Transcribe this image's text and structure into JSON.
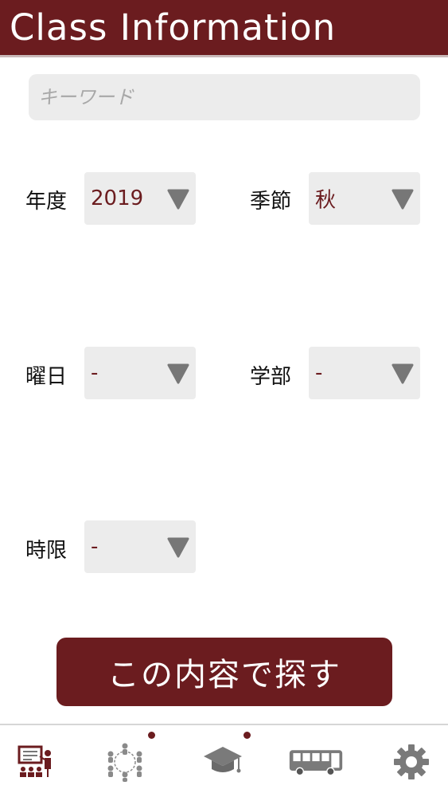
{
  "header": {
    "title": "Class Information"
  },
  "search": {
    "placeholder": "キーワード"
  },
  "fields": {
    "year": {
      "label": "年度",
      "value": "2019"
    },
    "season": {
      "label": "季節",
      "value": "秋"
    },
    "day": {
      "label": "曜日",
      "value": "-"
    },
    "faculty": {
      "label": "学部",
      "value": "-"
    },
    "period": {
      "label": "時限",
      "value": "-"
    }
  },
  "search_button": {
    "label": "この内容で探す"
  },
  "nav": {
    "items": [
      {
        "icon": "classroom-teacher-icon",
        "badge": false
      },
      {
        "icon": "community-circle-icon",
        "badge": true
      },
      {
        "icon": "graduation-cap-icon",
        "badge": true
      },
      {
        "icon": "bus-icon",
        "badge": false
      },
      {
        "icon": "gear-icon",
        "badge": false
      }
    ]
  },
  "colors": {
    "brand": "#6b1c1f",
    "field_bg": "#ececec",
    "icon_gray": "#777777"
  }
}
